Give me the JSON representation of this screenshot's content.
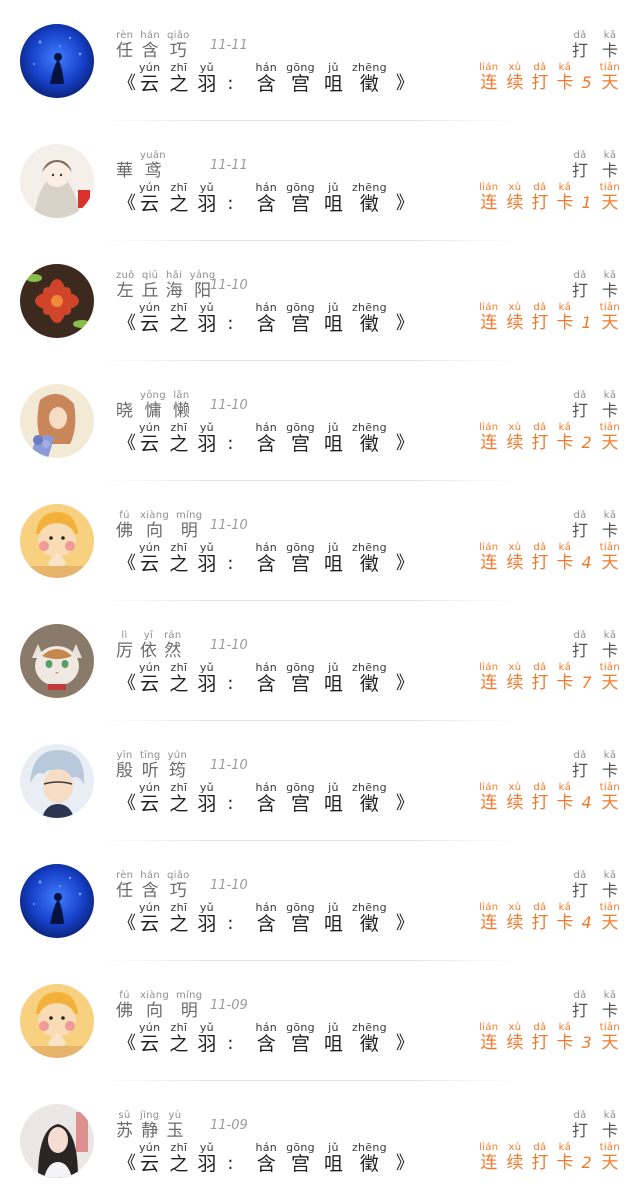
{
  "book_title": {
    "open": "《",
    "close": "》",
    "colon": ":",
    "series": [
      {
        "hz": "云",
        "py": "yún"
      },
      {
        "hz": "之",
        "py": "zhī"
      },
      {
        "hz": "羽",
        "py": "yǔ"
      }
    ],
    "part": [
      {
        "hz": "含",
        "py": "hán"
      },
      {
        "hz": "宫",
        "py": "gōng"
      },
      {
        "hz": "咀",
        "py": "jǔ"
      },
      {
        "hz": "徵",
        "py": "zhēng"
      }
    ]
  },
  "daka": [
    {
      "hz": "打",
      "py": "dǎ"
    },
    {
      "hz": "卡",
      "py": "kǎ"
    }
  ],
  "streak": {
    "prefix": [
      {
        "hz": "连",
        "py": "lián"
      },
      {
        "hz": "续",
        "py": "xù"
      },
      {
        "hz": "打",
        "py": "dǎ"
      },
      {
        "hz": "卡",
        "py": "kǎ"
      }
    ],
    "suffix": {
      "hz": "天",
      "py": "tiān"
    }
  },
  "colors": {
    "accent": "#f07a2c",
    "text": "#1f1f1f",
    "muted": "#9b9b9b"
  },
  "entries": [
    {
      "name": [
        {
          "hz": "任",
          "py": "rèn"
        },
        {
          "hz": "含",
          "py": "hán"
        },
        {
          "hz": "巧",
          "py": "qiǎo"
        }
      ],
      "date": "11-11",
      "days": "5",
      "avatar": "blue-aquarium"
    },
    {
      "name": [
        {
          "hz": "華",
          "py": ""
        },
        {
          "hz": "鸢",
          "py": "yuān"
        }
      ],
      "date": "11-11",
      "days": "1",
      "avatar": "anime-girl-white"
    },
    {
      "name": [
        {
          "hz": "左",
          "py": "zuǒ"
        },
        {
          "hz": "丘",
          "py": "qiū"
        },
        {
          "hz": "海",
          "py": "hǎi"
        },
        {
          "hz": "阳",
          "py": "yáng"
        }
      ],
      "date": "11-10",
      "days": "1",
      "avatar": "succulent"
    },
    {
      "name": [
        {
          "hz": "晓",
          "py": ""
        },
        {
          "hz": "慵",
          "py": "yōng"
        },
        {
          "hz": "懒",
          "py": "lǎn"
        }
      ],
      "date": "11-10",
      "days": "2",
      "avatar": "painted-girl"
    },
    {
      "name": [
        {
          "hz": "佛",
          "py": "fú"
        },
        {
          "hz": "向",
          "py": "xiàng"
        },
        {
          "hz": "明",
          "py": "míng"
        }
      ],
      "date": "11-10",
      "days": "4",
      "avatar": "cartoon-kid"
    },
    {
      "name": [
        {
          "hz": "厉",
          "py": "lì"
        },
        {
          "hz": "依",
          "py": "yī"
        },
        {
          "hz": "然",
          "py": "rán"
        }
      ],
      "date": "11-10",
      "days": "7",
      "avatar": "cat"
    },
    {
      "name": [
        {
          "hz": "殷",
          "py": "yīn"
        },
        {
          "hz": "听",
          "py": "tīng"
        },
        {
          "hz": "筠",
          "py": "yún"
        }
      ],
      "date": "11-10",
      "days": "4",
      "avatar": "anime-silver-hair"
    },
    {
      "name": [
        {
          "hz": "任",
          "py": "rèn"
        },
        {
          "hz": "含",
          "py": "hán"
        },
        {
          "hz": "巧",
          "py": "qiǎo"
        }
      ],
      "date": "11-10",
      "days": "4",
      "avatar": "blue-aquarium"
    },
    {
      "name": [
        {
          "hz": "佛",
          "py": "fú"
        },
        {
          "hz": "向",
          "py": "xiàng"
        },
        {
          "hz": "明",
          "py": "míng"
        }
      ],
      "date": "11-09",
      "days": "3",
      "avatar": "cartoon-kid"
    },
    {
      "name": [
        {
          "hz": "苏",
          "py": "sū"
        },
        {
          "hz": "静",
          "py": "jìng"
        },
        {
          "hz": "玉",
          "py": "yù"
        }
      ],
      "date": "11-09",
      "days": "2",
      "avatar": "girl-photo"
    }
  ]
}
